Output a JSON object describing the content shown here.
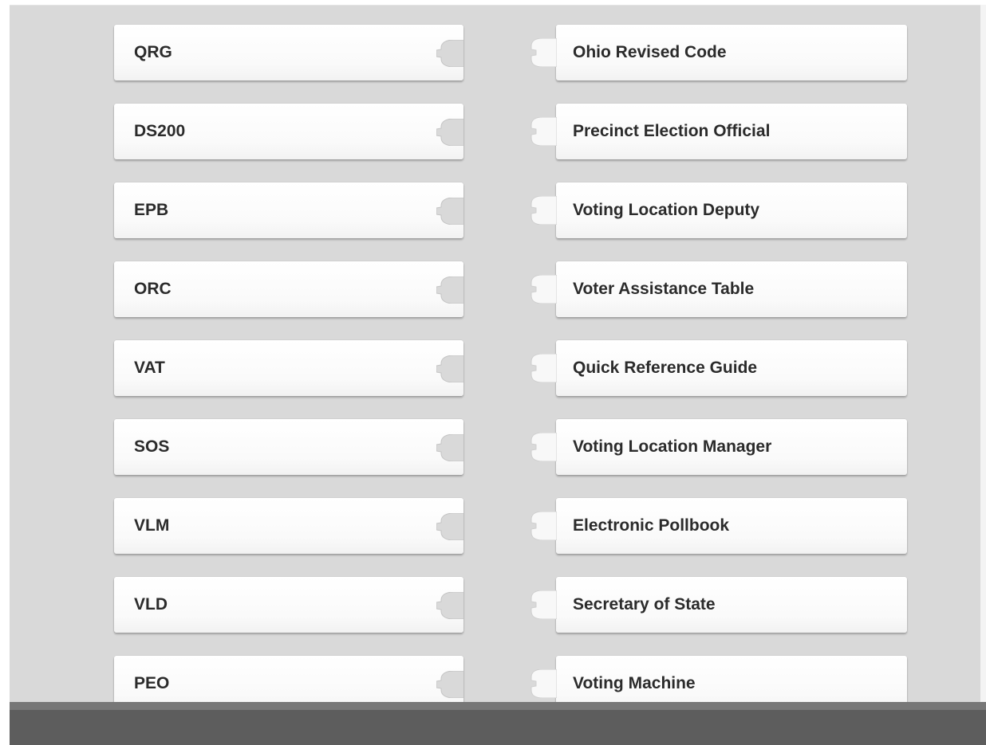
{
  "left_column": {
    "items": [
      {
        "label": "QRG"
      },
      {
        "label": "DS200"
      },
      {
        "label": "EPB"
      },
      {
        "label": "ORC"
      },
      {
        "label": "VAT"
      },
      {
        "label": "SOS"
      },
      {
        "label": "VLM"
      },
      {
        "label": "VLD"
      },
      {
        "label": "PEO"
      }
    ]
  },
  "right_column": {
    "items": [
      {
        "label": "Ohio Revised Code"
      },
      {
        "label": "Precinct Election Official"
      },
      {
        "label": "Voting Location Deputy"
      },
      {
        "label": "Voter Assistance Table"
      },
      {
        "label": "Quick Reference Guide"
      },
      {
        "label": "Voting Location Manager"
      },
      {
        "label": "Electronic Pollbook"
      },
      {
        "label": "Secretary of State"
      },
      {
        "label": "Voting Machine"
      }
    ]
  },
  "colors": {
    "stage_background": "#d9d9d9",
    "piece_background": "#ffffff",
    "label_text": "#2b2b2b",
    "bottom_bar": "#5d5d5d"
  },
  "icons": {
    "left_piece_connector": "puzzle-socket-icon",
    "right_piece_connector": "puzzle-tab-icon"
  }
}
